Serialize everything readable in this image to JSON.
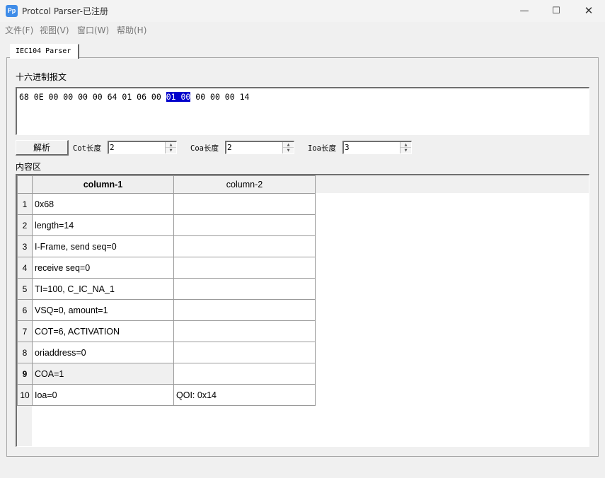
{
  "window": {
    "icon_text": "Pp",
    "title": "Protcol Parser-已注册",
    "minimize": "—",
    "maximize": "☐",
    "close": "✕"
  },
  "menu": [
    "文件(F)",
    "视图(V)",
    "窗口(W)",
    "帮助(H)"
  ],
  "tab": {
    "label": "IEC104 Parser"
  },
  "hex": {
    "label": "十六进制报文",
    "before": "68 0E 00 00 00 00 64 01 06 00 ",
    "selected": "01 00",
    "after": " 00 00 00 14"
  },
  "controls": {
    "parse_label": "解析",
    "cot_label": "Cot长度",
    "cot_value": "2",
    "coa_label": "Coa长度",
    "coa_value": "2",
    "ioa_label": "Ioa长度",
    "ioa_value": "3"
  },
  "content_label": "内容区",
  "table": {
    "headers": [
      "column-1",
      "column-2"
    ],
    "rows": [
      {
        "num": "1",
        "c1": "0x68",
        "c2": ""
      },
      {
        "num": "2",
        "c1": "length=14",
        "c2": ""
      },
      {
        "num": "3",
        "c1": "I-Frame, send seq=0",
        "c2": ""
      },
      {
        "num": "4",
        "c1": "receive seq=0",
        "c2": ""
      },
      {
        "num": "5",
        "c1": "TI=100, C_IC_NA_1",
        "c2": ""
      },
      {
        "num": "6",
        "c1": "VSQ=0, amount=1",
        "c2": ""
      },
      {
        "num": "7",
        "c1": "COT=6,  ACTIVATION",
        "c2": ""
      },
      {
        "num": "8",
        "c1": "oriaddress=0",
        "c2": ""
      },
      {
        "num": "9",
        "c1": "COA=1",
        "c2": ""
      },
      {
        "num": "10",
        "c1": "Ioa=0",
        "c2": "QOI: 0x14"
      }
    ],
    "selected_row": "9"
  }
}
